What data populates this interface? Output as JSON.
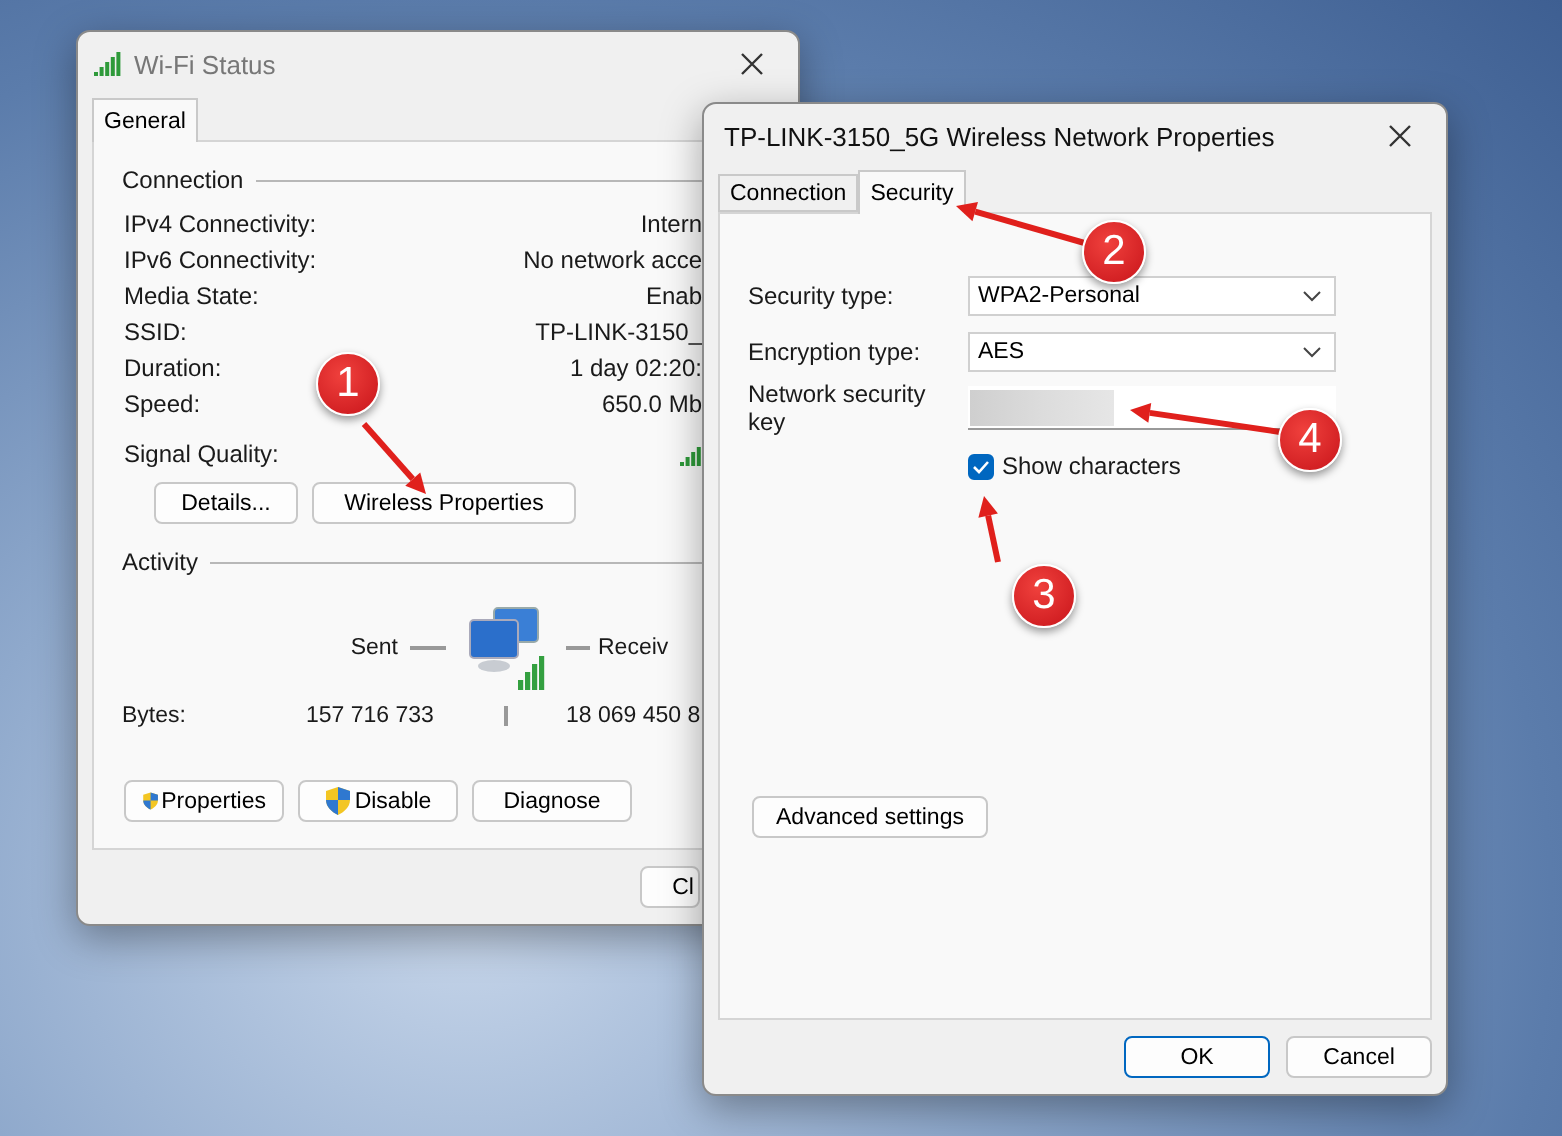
{
  "status_window": {
    "title": "Wi-Fi Status",
    "tabs": [
      {
        "label": "General",
        "selected": true
      }
    ],
    "connection": {
      "title": "Connection",
      "rows": [
        {
          "label": "IPv4 Connectivity:",
          "value": "Intern"
        },
        {
          "label": "IPv6 Connectivity:",
          "value": "No network acce"
        },
        {
          "label": "Media State:",
          "value": "Enab"
        },
        {
          "label": "SSID:",
          "value": "TP-LINK-3150_"
        },
        {
          "label": "Duration:",
          "value": "1 day 02:20:"
        },
        {
          "label": "Speed:",
          "value": "650.0 Mb"
        }
      ],
      "signal_label": "Signal Quality:",
      "buttons": [
        "Details...",
        "Wireless Properties"
      ]
    },
    "activity": {
      "title": "Activity",
      "sent_label": "Sent",
      "received_label": "Receiv",
      "bytes_label": "Bytes:",
      "bytes_sent": "157 716 733",
      "bytes_received": "18 069 450 8"
    },
    "buttons": [
      {
        "label": "Properties",
        "shield": true
      },
      {
        "label": "Disable",
        "shield": true
      },
      {
        "label": "Diagnose",
        "shield": false
      }
    ],
    "close_button": "Cl"
  },
  "properties_window": {
    "title": "TP-LINK-3150_5G Wireless Network Properties",
    "tabs": [
      {
        "label": "Connection",
        "selected": false
      },
      {
        "label": "Security",
        "selected": true
      }
    ],
    "fields": [
      {
        "kind": "select",
        "label": "Security type:",
        "value": "WPA2-Personal"
      },
      {
        "kind": "select",
        "label": "Encryption type:",
        "value": "AES"
      },
      {
        "kind": "masked",
        "label": "Network security key"
      }
    ],
    "show_characters": {
      "label": "Show characters",
      "checked": true
    },
    "advanced_button": "Advanced settings",
    "buttons": [
      {
        "label": "OK",
        "default": true
      },
      {
        "label": "Cancel",
        "default": false
      }
    ]
  },
  "annotations": [
    {
      "number": "1"
    },
    {
      "number": "2"
    },
    {
      "number": "3"
    },
    {
      "number": "4"
    }
  ]
}
